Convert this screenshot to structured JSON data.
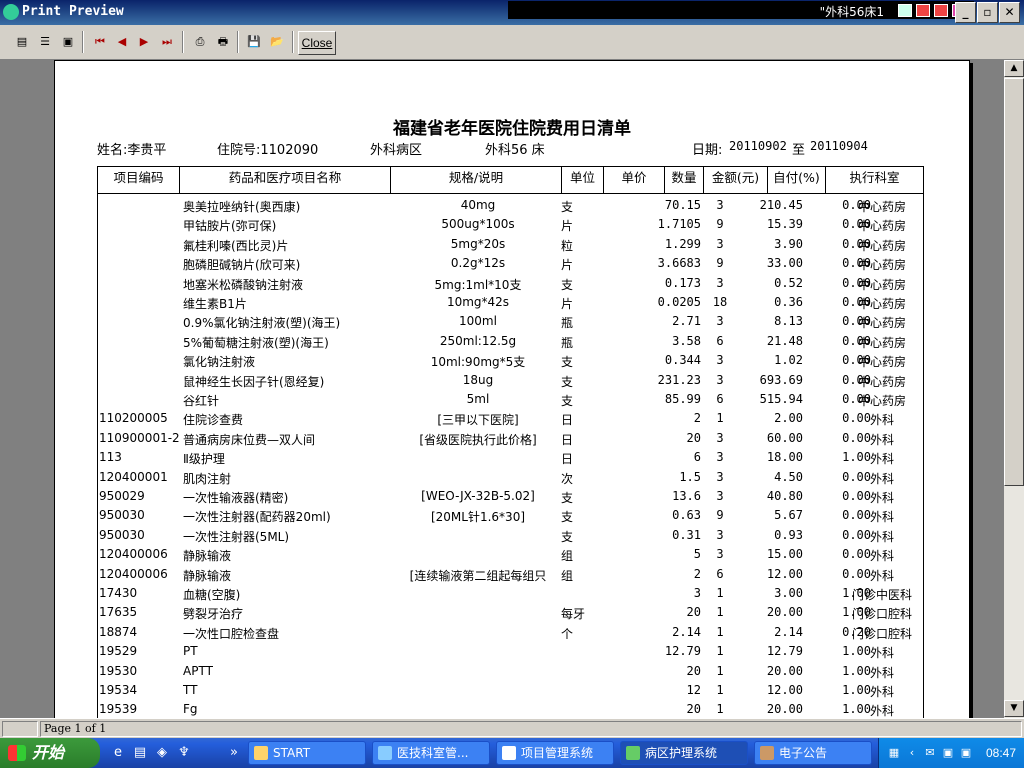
{
  "window": {
    "title": "Print Preview",
    "tray_text": "\"外科56床1",
    "close_label": "Close"
  },
  "toolbar": {
    "buttons": [
      "one-page",
      "two-pages",
      "multi-pages",
      "first",
      "prev",
      "next",
      "last",
      "print-setup",
      "print",
      "save",
      "open"
    ]
  },
  "document": {
    "title": "福建省老年医院住院费用日清单",
    "patient": "姓名:李贵平",
    "inpatient_no": "住院号:1102090",
    "ward": "外科病区",
    "bed": "外科56 床",
    "date_label": "日期:",
    "date_from": "20110902",
    "date_to_label": "至",
    "date_to": "20110904",
    "columns": [
      "项目编码",
      "药品和医疗项目名称",
      "规格/说明",
      "单位",
      "单价",
      "数量",
      "金额(元)",
      "自付(%)",
      "执行科室"
    ],
    "rows": [
      {
        "code": "",
        "name": "奥美拉唑纳针(奥西康)",
        "spec": "40mg",
        "unit": "支",
        "price": "70.15",
        "qty": "3",
        "amount": "210.45",
        "self": "0.00",
        "dept": "中心药房"
      },
      {
        "code": "",
        "name": "甲钴胺片(弥可保)",
        "spec": "500ug*100s",
        "unit": "片",
        "price": "1.7105",
        "qty": "9",
        "amount": "15.39",
        "self": "0.00",
        "dept": "中心药房"
      },
      {
        "code": "",
        "name": "氟桂利嗪(西比灵)片",
        "spec": "5mg*20s",
        "unit": "粒",
        "price": "1.299",
        "qty": "3",
        "amount": "3.90",
        "self": "0.00",
        "dept": "中心药房"
      },
      {
        "code": "",
        "name": "胞磷胆碱钠片(欣可来)",
        "spec": "0.2g*12s",
        "unit": "片",
        "price": "3.6683",
        "qty": "9",
        "amount": "33.00",
        "self": "0.00",
        "dept": "中心药房"
      },
      {
        "code": "",
        "name": "地塞米松磷酸钠注射液",
        "spec": "5mg:1ml*10支",
        "unit": "支",
        "price": "0.173",
        "qty": "3",
        "amount": "0.52",
        "self": "0.00",
        "dept": "中心药房"
      },
      {
        "code": "",
        "name": "维生素B1片",
        "spec": "10mg*42s",
        "unit": "片",
        "price": "0.0205",
        "qty": "18",
        "amount": "0.36",
        "self": "0.00",
        "dept": "中心药房"
      },
      {
        "code": "",
        "name": "0.9%氯化钠注射液(塑)(海王)",
        "spec": "100ml",
        "unit": "瓶",
        "price": "2.71",
        "qty": "3",
        "amount": "8.13",
        "self": "0.00",
        "dept": "中心药房"
      },
      {
        "code": "",
        "name": "5%葡萄糖注射液(塑)(海王)",
        "spec": "250ml:12.5g",
        "unit": "瓶",
        "price": "3.58",
        "qty": "6",
        "amount": "21.48",
        "self": "0.00",
        "dept": "中心药房"
      },
      {
        "code": "",
        "name": "氯化钠注射液",
        "spec": "10ml:90mg*5支",
        "unit": "支",
        "price": "0.344",
        "qty": "3",
        "amount": "1.02",
        "self": "0.00",
        "dept": "中心药房"
      },
      {
        "code": "",
        "name": "鼠神经生长因子针(恩经复)",
        "spec": "18ug",
        "unit": "支",
        "price": "231.23",
        "qty": "3",
        "amount": "693.69",
        "self": "0.00",
        "dept": "中心药房"
      },
      {
        "code": "",
        "name": "谷红针",
        "spec": "5ml",
        "unit": "支",
        "price": "85.99",
        "qty": "6",
        "amount": "515.94",
        "self": "0.00",
        "dept": "中心药房"
      },
      {
        "code": "110200005",
        "name": "住院诊查费",
        "spec": "[三甲以下医院]",
        "unit": "日",
        "price": "2",
        "qty": "1",
        "amount": "2.00",
        "self": "0.00",
        "dept": "外科"
      },
      {
        "code": "110900001-2",
        "name": "普通病房床位费—双人间",
        "spec": "[省级医院执行此价格]",
        "unit": "日",
        "price": "20",
        "qty": "3",
        "amount": "60.00",
        "self": "0.00",
        "dept": "外科"
      },
      {
        "code": "113",
        "name": "Ⅱ级护理",
        "spec": "",
        "unit": "日",
        "price": "6",
        "qty": "3",
        "amount": "18.00",
        "self": "1.00",
        "dept": "外科"
      },
      {
        "code": "120400001",
        "name": "肌肉注射",
        "spec": "",
        "unit": "次",
        "price": "1.5",
        "qty": "3",
        "amount": "4.50",
        "self": "0.00",
        "dept": "外科"
      },
      {
        "code": "950029",
        "name": "一次性输液器(精密)",
        "spec": "[WEO-JX-32B-5.02]",
        "unit": "支",
        "price": "13.6",
        "qty": "3",
        "amount": "40.80",
        "self": "0.00",
        "dept": "外科"
      },
      {
        "code": "950030",
        "name": "一次性注射器(配药器20ml)",
        "spec": "[20ML针1.6*30]",
        "unit": "支",
        "price": "0.63",
        "qty": "9",
        "amount": "5.67",
        "self": "0.00",
        "dept": "外科"
      },
      {
        "code": "950030",
        "name": "一次性注射器(5ML)",
        "spec": "",
        "unit": "支",
        "price": "0.31",
        "qty": "3",
        "amount": "0.93",
        "self": "0.00",
        "dept": "外科"
      },
      {
        "code": "120400006",
        "name": "静脉输液",
        "spec": "",
        "unit": "组",
        "price": "5",
        "qty": "3",
        "amount": "15.00",
        "self": "0.00",
        "dept": "外科"
      },
      {
        "code": "120400006",
        "name": "静脉输液",
        "spec": "[连续输液第二组起每组只",
        "unit": "组",
        "price": "2",
        "qty": "6",
        "amount": "12.00",
        "self": "0.00",
        "dept": "外科"
      },
      {
        "code": "17430",
        "name": "血糖(空腹)",
        "spec": "",
        "unit": "",
        "price": "3",
        "qty": "1",
        "amount": "3.00",
        "self": "1.00",
        "dept": "门诊中医科"
      },
      {
        "code": "17635",
        "name": "劈裂牙治疗",
        "spec": "",
        "unit": "每牙",
        "price": "20",
        "qty": "1",
        "amount": "20.00",
        "self": "1.00",
        "dept": "门诊口腔科"
      },
      {
        "code": "18874",
        "name": "一次性口腔检查盘",
        "spec": "",
        "unit": "个",
        "price": "2.14",
        "qty": "1",
        "amount": "2.14",
        "self": "0.20",
        "dept": "门诊口腔科"
      },
      {
        "code": "19529",
        "name": "PT",
        "spec": "",
        "unit": "",
        "price": "12.79",
        "qty": "1",
        "amount": "12.79",
        "self": "1.00",
        "dept": "外科"
      },
      {
        "code": "19530",
        "name": "APTT",
        "spec": "",
        "unit": "",
        "price": "20",
        "qty": "1",
        "amount": "20.00",
        "self": "1.00",
        "dept": "外科"
      },
      {
        "code": "19534",
        "name": "TT",
        "spec": "",
        "unit": "",
        "price": "12",
        "qty": "1",
        "amount": "12.00",
        "self": "1.00",
        "dept": "外科"
      },
      {
        "code": "19539",
        "name": "Fg",
        "spec": "",
        "unit": "",
        "price": "20",
        "qty": "1",
        "amount": "20.00",
        "self": "1.00",
        "dept": "外科"
      }
    ]
  },
  "status": {
    "page": "Page 1 of 1"
  },
  "taskbar": {
    "start_label": "开始",
    "tasks": [
      {
        "label": "START"
      },
      {
        "label": "医技科室管..."
      },
      {
        "label": "项目管理系统"
      },
      {
        "label": "病区护理系统"
      },
      {
        "label": "电子公告"
      }
    ],
    "clock": "08:47"
  }
}
